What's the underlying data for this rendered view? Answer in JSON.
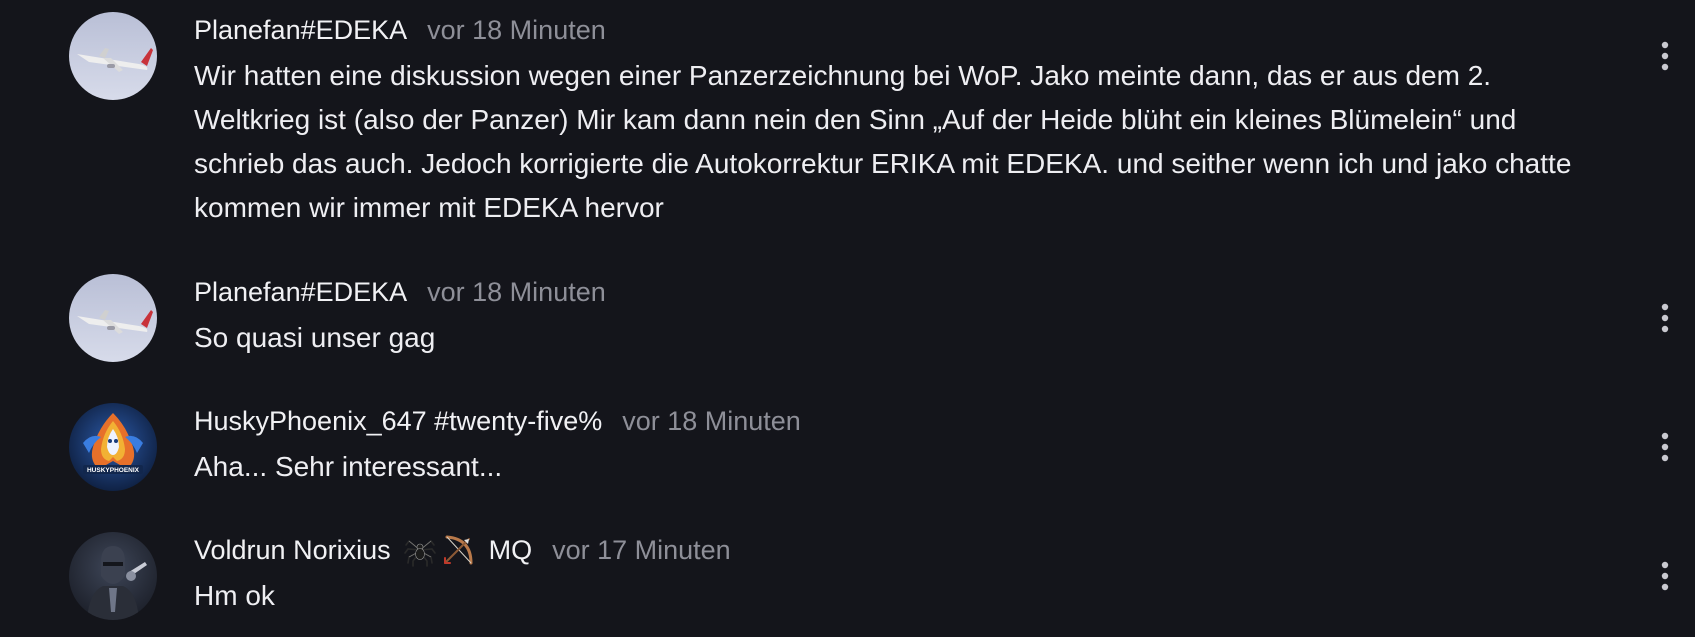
{
  "comments": [
    {
      "author": "Planefan#EDEKA",
      "time": "vor 18 Minuten",
      "text": "Wir hatten eine diskussion wegen einer Panzerzeichnung bei WoP. Jako meinte dann, das er aus dem 2. Weltkrieg ist (also der Panzer) Mir kam dann nein den Sinn „Auf der Heide blüht ein kleines Blümelein“ und schrieb das auch. Jedoch korrigierte die Autokorrektur ERIKA mit EDEKA. und seither wenn ich und jako chatte kommen wir immer mit EDEKA hervor",
      "avatar_icon": "airplane-avatar-icon"
    },
    {
      "author": "Planefan#EDEKA",
      "time": "vor 18 Minuten",
      "text": "So quasi unser gag",
      "avatar_icon": "airplane-avatar-icon"
    },
    {
      "author": "HuskyPhoenix_647 #twenty-five%",
      "time": "vor 18 Minuten",
      "text": "Aha... Sehr interessant...",
      "avatar_icon": "phoenix-avatar-icon",
      "avatar_label": "HUSKYPHOENIX"
    },
    {
      "author": "Voldrun Norixius",
      "badge_icons": [
        "spider-icon",
        "bow-arrow-icon"
      ],
      "badge_text": "MQ",
      "time": "vor 17 Minuten",
      "text": "Hm ok",
      "avatar_icon": "knight-avatar-icon"
    }
  ],
  "menu_icon": "more-vertical-icon",
  "colors": {
    "background": "#14151b",
    "text": "#eeeef2",
    "muted": "#8e8f98"
  }
}
